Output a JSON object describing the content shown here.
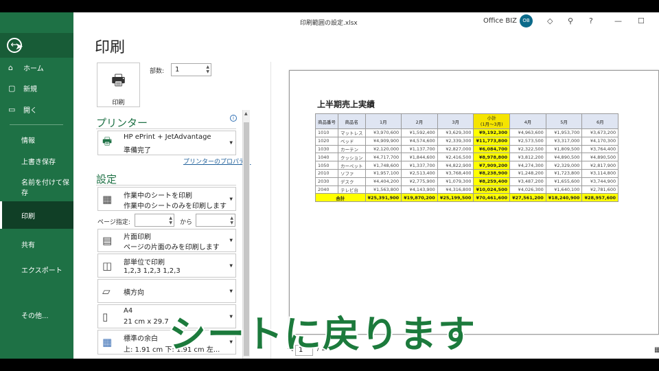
{
  "window": {
    "file_title": "印刷範囲の設定.xlsx",
    "user_name": "Office BIZ",
    "user_initials": "OB"
  },
  "sidebar": {
    "items": [
      {
        "label": "ホーム",
        "icon": "home-icon"
      },
      {
        "label": "新規",
        "icon": "new-file-icon"
      },
      {
        "label": "開く",
        "icon": "open-folder-icon"
      },
      {
        "label": "情報"
      },
      {
        "label": "上書き保存"
      },
      {
        "label": "名前を付けて保存"
      },
      {
        "label": "印刷"
      },
      {
        "label": "共有"
      },
      {
        "label": "エクスポート"
      },
      {
        "label": "その他..."
      }
    ]
  },
  "print": {
    "title": "印刷",
    "button_label": "印刷",
    "copies_label": "部数:",
    "copies_value": "1",
    "printer_section": "プリンター",
    "printer_name": "HP ePrint + JetAdvantage",
    "printer_status": "準備完了",
    "printer_properties": "プリンターのプロパティ",
    "settings_section": "設定",
    "settings": [
      {
        "line1": "作業中のシートを印刷",
        "line2": "作業中のシートのみを印刷します"
      },
      {
        "line1": "片面印刷",
        "line2": "ページの片面のみを印刷します"
      },
      {
        "line1": "部単位で印刷",
        "line2": "1,2,3    1,2,3    1,2,3"
      },
      {
        "line1": "横方向",
        "line2": ""
      },
      {
        "line1": "A4",
        "line2": "21 cm x 29.7"
      },
      {
        "line1": "標準の余白",
        "line2": "上: 1.91 cm 下: 1.91 cm 左..."
      }
    ],
    "pages_label": "ページ指定:",
    "pages_to": "から"
  },
  "preview": {
    "sheet_title": "上半期売上実績",
    "headers": [
      "商品番号",
      "商品名",
      "1月",
      "2月",
      "3月",
      "小計\n(1月～3月)",
      "4月",
      "5月",
      "6月"
    ],
    "rows": [
      [
        "1010",
        "マットレス",
        "¥3,970,600",
        "¥1,592,400",
        "¥3,629,300",
        "¥9,192,300",
        "¥4,963,600",
        "¥1,953,700",
        "¥3,673,200"
      ],
      [
        "1020",
        "ベッド",
        "¥4,909,900",
        "¥4,574,600",
        "¥2,339,300",
        "¥11,773,800",
        "¥2,573,500",
        "¥3,317,000",
        "¥4,170,300"
      ],
      [
        "1030",
        "カーテン",
        "¥2,120,000",
        "¥1,137,700",
        "¥2,827,000",
        "¥6,084,700",
        "¥2,322,500",
        "¥1,809,500",
        "¥3,764,400"
      ],
      [
        "1040",
        "クッション",
        "¥4,717,700",
        "¥1,844,600",
        "¥2,416,500",
        "¥8,978,800",
        "¥3,812,200",
        "¥4,890,500",
        "¥4,890,500"
      ],
      [
        "1050",
        "カーペット",
        "¥1,748,600",
        "¥1,337,700",
        "¥4,822,900",
        "¥7,909,200",
        "¥4,274,300",
        "¥2,329,000",
        "¥2,817,900"
      ],
      [
        "2010",
        "ソファ",
        "¥1,957,100",
        "¥2,513,400",
        "¥3,768,400",
        "¥8,238,900",
        "¥1,248,200",
        "¥1,723,800",
        "¥3,114,800"
      ],
      [
        "2030",
        "デスク",
        "¥4,404,200",
        "¥2,775,900",
        "¥1,079,300",
        "¥8,259,400",
        "¥3,487,200",
        "¥1,655,600",
        "¥3,744,900"
      ],
      [
        "2040",
        "テレビ台",
        "¥1,563,800",
        "¥4,143,900",
        "¥4,316,800",
        "¥10,024,500",
        "¥4,026,300",
        "¥1,640,100",
        "¥2,781,600"
      ]
    ],
    "total_label": "合計",
    "totals": [
      "¥25,391,900",
      "¥19,870,200",
      "¥25,199,500",
      "¥70,461,600",
      "¥27,561,200",
      "¥18,240,900",
      "¥28,957,600"
    ],
    "page_current": "1",
    "page_total": "/ 2"
  },
  "caption": "シートに戻ります"
}
